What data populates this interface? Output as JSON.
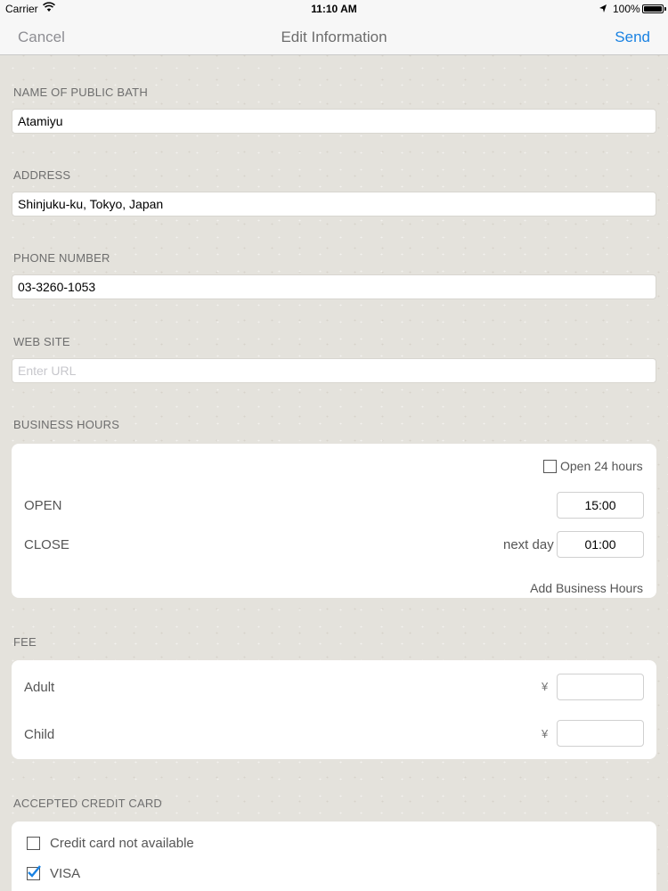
{
  "status_bar": {
    "carrier": "Carrier",
    "time": "11:10 AM",
    "battery_percent": "100%",
    "wifi_icon": "wifi-icon",
    "location_icon": "location-arrow-icon"
  },
  "nav": {
    "cancel_label": "Cancel",
    "title": "Edit Information",
    "send_label": "Send",
    "accent_color": "#1a82e2"
  },
  "form": {
    "bath_name": {
      "label": "NAME OF PUBLIC BATH",
      "value": "Atamiyu"
    },
    "address": {
      "label": "ADDRESS",
      "value": "Shinjuku-ku, Tokyo, Japan"
    },
    "phone": {
      "label": "PHONE NUMBER",
      "value": "03-3260-1053"
    },
    "website": {
      "label": "WEB SITE",
      "value": "",
      "placeholder": "Enter URL"
    }
  },
  "business_hours": {
    "label": "BUSINESS HOURS",
    "open_24_label": "Open 24 hours",
    "open_24_checked": false,
    "open_label": "OPEN",
    "open_time": "15:00",
    "close_label": "CLOSE",
    "next_day_label": "next day",
    "close_time": "01:00",
    "add_label": "Add Business Hours"
  },
  "fee": {
    "label": "FEE",
    "adult_label": "Adult",
    "child_label": "Child",
    "currency": "¥",
    "adult_value": "",
    "child_value": ""
  },
  "credit_card": {
    "label": "ACCEPTED CREDIT CARD",
    "options": [
      {
        "label": "Credit card not available",
        "checked": false
      },
      {
        "label": "VISA",
        "checked": true
      }
    ]
  }
}
